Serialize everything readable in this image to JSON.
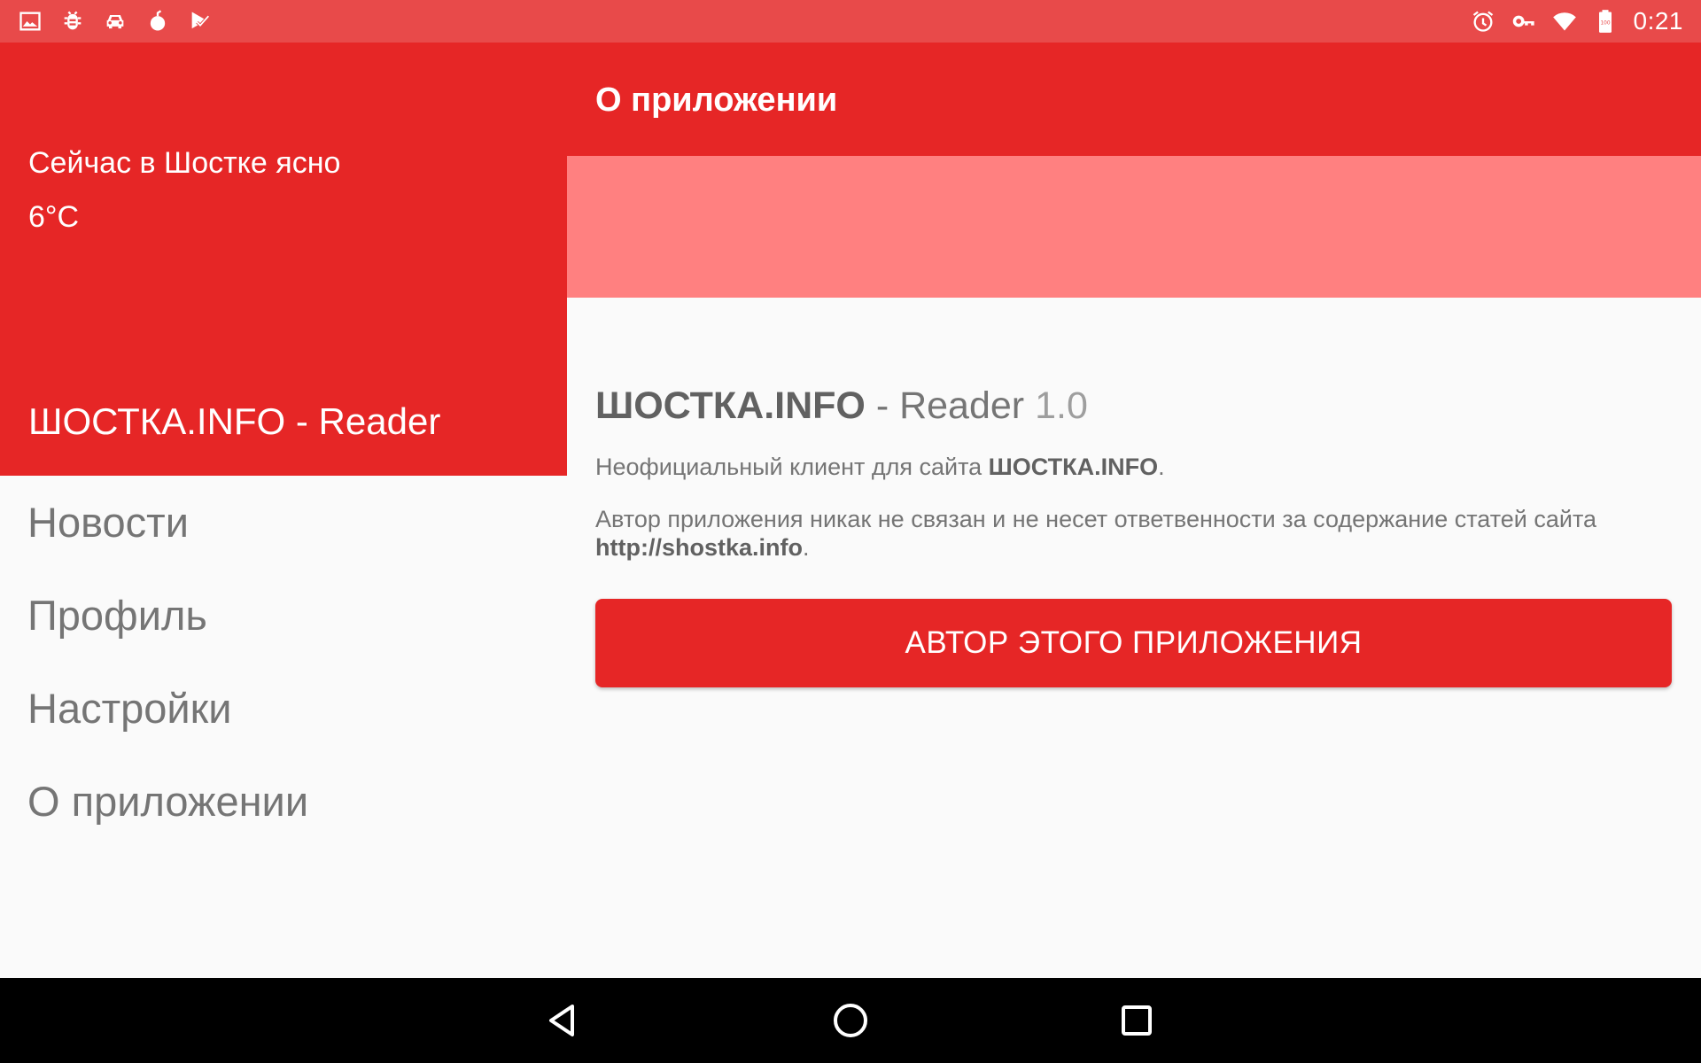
{
  "status_bar": {
    "time": "0:21",
    "left_icons": [
      "image-icon",
      "bug-icon",
      "car-icon",
      "bomb-icon",
      "play-check-icon"
    ],
    "right_icons": [
      "alarm-icon",
      "vpn-key-icon",
      "wifi-icon",
      "battery-icon"
    ],
    "battery_text": "100"
  },
  "colors": {
    "primary": "#e62626",
    "status_bar": "#e84a4a",
    "banner": "#ff8080",
    "background": "#fafafa",
    "text_gray": "#757575"
  },
  "drawer": {
    "weather_text": "Сейчас в Шостке ясно",
    "weather_temp": "6°C",
    "app_title": "ШОСТКА.INFO - Reader",
    "items": [
      {
        "label": "Новости"
      },
      {
        "label": "Профиль"
      },
      {
        "label": "Настройки"
      },
      {
        "label": "О приложении"
      }
    ]
  },
  "toolbar": {
    "title": "О приложении"
  },
  "about": {
    "app_name": "ШОСТКА.INFO",
    "name_sep": " - Reader ",
    "version": "1.0",
    "p1_text": "Неофициальный клиент для сайта ",
    "p1_site": "ШОСТКА.INFO",
    "p1_end": ".",
    "p2_text": "Автор приложения никак не связан и не несет ответвенности за содержание статей сайта ",
    "p2_url": "http://shostka.info",
    "p2_end": ".",
    "button_label": "АВТОР ЭТОГО ПРИЛОЖЕНИЯ"
  },
  "nav_bar": {
    "buttons": [
      "back-icon",
      "home-icon",
      "recents-icon"
    ]
  }
}
